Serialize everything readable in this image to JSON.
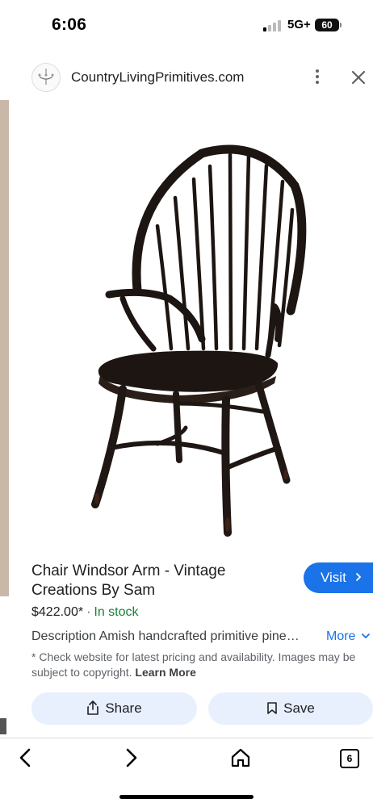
{
  "status_bar": {
    "time": "6:06",
    "network": "5G+",
    "battery": "60"
  },
  "header": {
    "site_name": "CountryLivingPrimitives.com",
    "favicon_icon": "chandelier-icon",
    "menu_icon": "more-vert-icon",
    "close_icon": "close-icon"
  },
  "product": {
    "image_alt": "Windsor arm chair in black finish",
    "title": "Chair Windsor Arm - Vintage Creations By Sam",
    "price": "$422.00*",
    "separator": "·",
    "availability": "In stock",
    "description": "Description Amish handcrafted primitive pine…",
    "more_label": "More",
    "disclaimer": "* Check website for latest pricing and availability. Images may be subject to copyright.",
    "learn_more": "Learn More"
  },
  "actions": {
    "visit_label": "Visit",
    "share_label": "Share",
    "save_label": "Save"
  },
  "bottom_nav": {
    "tab_count": "6"
  },
  "colors": {
    "accent": "#1a73e8",
    "in_stock": "#188038",
    "pill_bg": "#e8f0fe"
  }
}
